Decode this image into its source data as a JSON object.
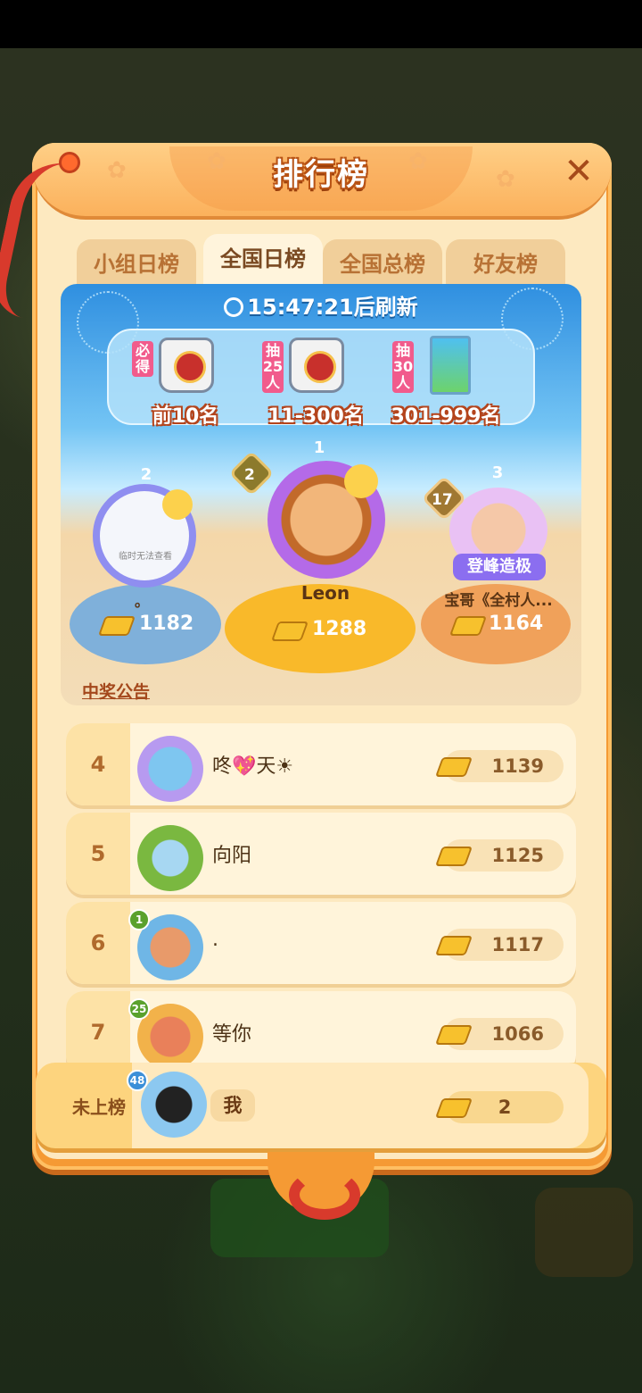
{
  "title": "排行榜",
  "tabs": [
    {
      "label": "小组日榜",
      "active": false
    },
    {
      "label": "全国日榜",
      "active": true
    },
    {
      "label": "全国总榜",
      "active": false
    },
    {
      "label": "好友榜",
      "active": false
    }
  ],
  "timer": {
    "time": "15:47:21",
    "suffix": "后刷新"
  },
  "rewards": [
    {
      "tag": "必得",
      "label": "前10名",
      "icon": "bag-icon"
    },
    {
      "tag": "抽25人",
      "label": "11-300名",
      "icon": "bag-icon"
    },
    {
      "tag": "抽30人",
      "label": "301-999名",
      "icon": "book-icon"
    }
  ],
  "podium": [
    {
      "rank": "1",
      "level": "2",
      "name": "Leon",
      "score": "1288"
    },
    {
      "rank": "2",
      "level": "",
      "name": "。",
      "score": "1182",
      "avatar_text": "临时无法查看"
    },
    {
      "rank": "3",
      "level": "17",
      "name": "宝哥《全村人...",
      "score": "1164",
      "frame_text": "登峰造极"
    }
  ],
  "winner_link": "中奖公告",
  "rows": [
    {
      "rank": "4",
      "name": "咚💖天☀",
      "score": "1139",
      "level": ""
    },
    {
      "rank": "5",
      "name": "向阳",
      "score": "1125",
      "level": ""
    },
    {
      "rank": "6",
      "name": ".",
      "score": "1117",
      "level": "1"
    },
    {
      "rank": "7",
      "name": "等你",
      "score": "1066",
      "level": "25"
    }
  ],
  "self": {
    "status": "未上榜",
    "name": "我",
    "score": "2",
    "level": "48"
  },
  "colors": {
    "panel": "#f59a34",
    "gold": "#f7c12d",
    "first": "#f7b72a",
    "second": "#9ec9ea",
    "third": "#e6a064"
  }
}
